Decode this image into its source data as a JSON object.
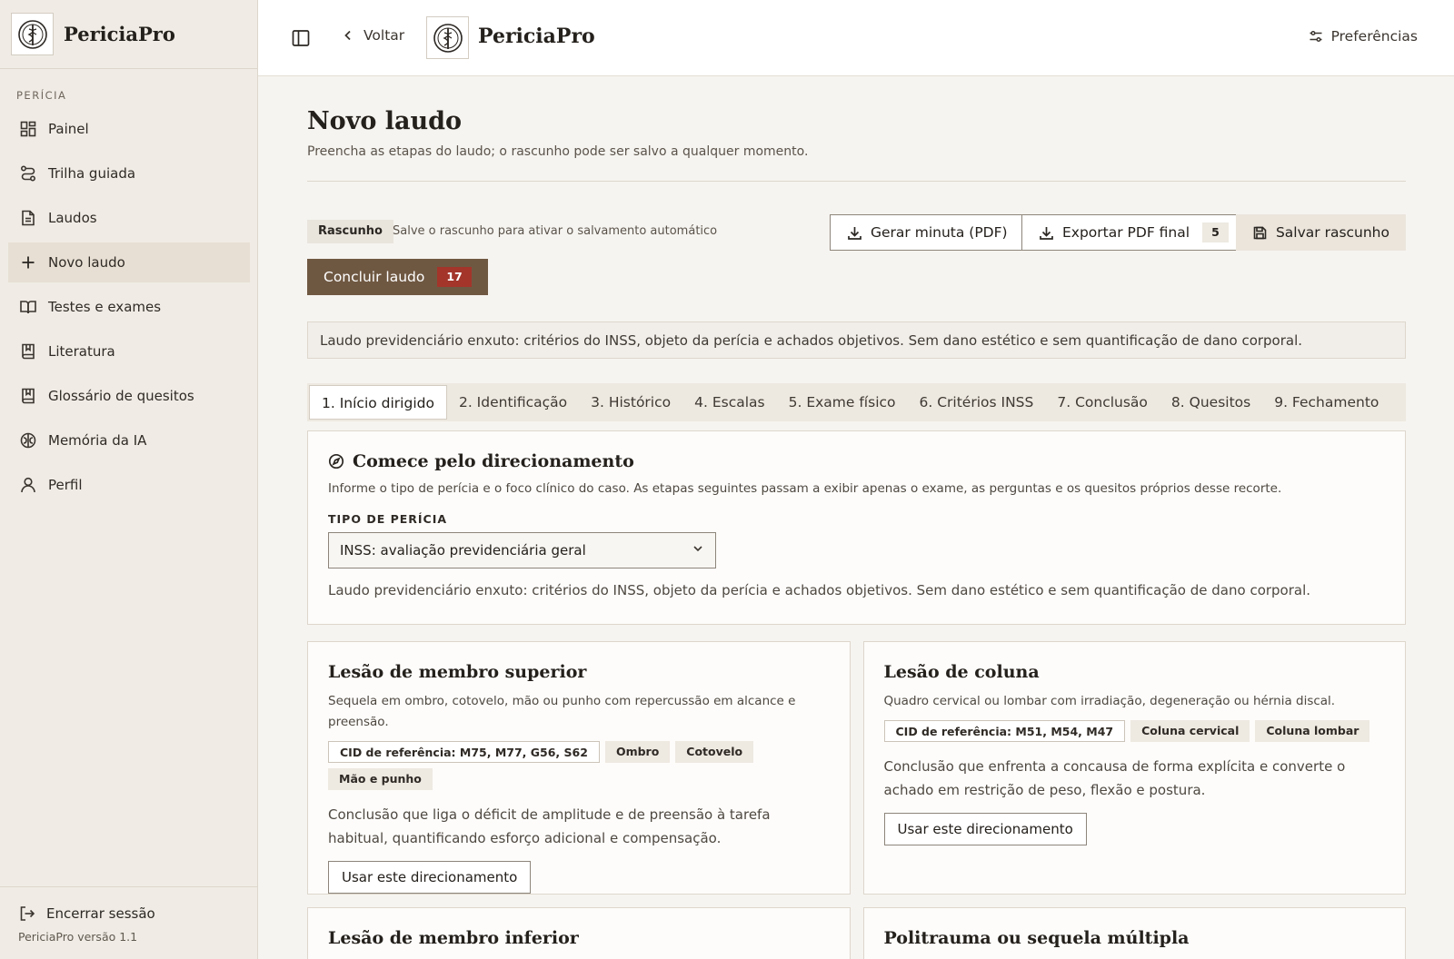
{
  "brand": {
    "name": "PericiaPro"
  },
  "sidebar": {
    "section": "PERÍCIA",
    "items": [
      {
        "label": "Painel",
        "icon": "dashboard-icon"
      },
      {
        "label": "Trilha guiada",
        "icon": "route-icon"
      },
      {
        "label": "Laudos",
        "icon": "file-icon"
      },
      {
        "label": "Novo laudo",
        "icon": "plus-icon",
        "active": true
      },
      {
        "label": "Testes e exames",
        "icon": "book-icon"
      },
      {
        "label": "Literatura",
        "icon": "book-bookmark-icon"
      },
      {
        "label": "Glossário de quesitos",
        "icon": "book-bookmark-icon"
      },
      {
        "label": "Memória da IA",
        "icon": "brain-icon"
      },
      {
        "label": "Perfil",
        "icon": "user-icon"
      }
    ],
    "logout": "Encerrar sessão",
    "version": "PericiaPro versão 1.1"
  },
  "topbar": {
    "back": "Voltar",
    "brand": "PericiaPro",
    "preferences": "Preferências"
  },
  "main": {
    "title": "Novo laudo",
    "subtitle": "Preencha as etapas do laudo; o rascunho pode ser salvo a qualquer momento.",
    "draft_badge": "Rascunho",
    "draft_hint": "Salve o rascunho para ativar o salvamento automático",
    "btn_minuta": "Gerar minuta (PDF)",
    "btn_export": "Exportar PDF final",
    "export_count": "5",
    "btn_save": "Salvar rascunho",
    "btn_conclude": "Concluir laudo",
    "conclude_count": "17",
    "note": "Laudo previdenciário enxuto: critérios do INSS, objeto da perícia e achados objetivos. Sem dano estético e sem quantificação de dano corporal.",
    "tabs": [
      "1. Início dirigido",
      "2. Identificação",
      "3. Histórico",
      "4. Escalas",
      "5. Exame físico",
      "6. Critérios INSS",
      "7. Conclusão",
      "8. Quesitos",
      "9. Fechamento"
    ],
    "direction": {
      "title": "Comece pelo direcionamento",
      "desc": "Informe o tipo de perícia e o foco clínico do caso. As etapas seguintes passam a exibir apenas o exame, as perguntas e os quesitos próprios desse recorte.",
      "field_label": "TIPO DE PERÍCIA",
      "select_value": "INSS: avaliação previdenciária geral",
      "help": "Laudo previdenciário enxuto: critérios do INSS, objeto da perícia e achados objetivos. Sem dano estético e sem quantificação de dano corporal."
    },
    "options": [
      {
        "title": "Lesão de membro superior",
        "desc": "Sequela em ombro, cotovelo, mão ou punho com repercussão em alcance e preensão.",
        "chips": [
          "CID de referência: M75, M77, G56, S62",
          "Ombro",
          "Cotovelo",
          "Mão e punho"
        ],
        "text": "Conclusão que liga o déficit de amplitude e de preensão à tarefa habitual, quantificando esforço adicional e compensação.",
        "button": "Usar este direcionamento"
      },
      {
        "title": "Lesão de coluna",
        "desc": "Quadro cervical ou lombar com irradiação, degeneração ou hérnia discal.",
        "chips": [
          "CID de referência: M51, M54, M47",
          "Coluna cervical",
          "Coluna lombar"
        ],
        "text": "Conclusão que enfrenta a concausa de forma explícita e converte o achado em restrição de peso, flexão e postura.",
        "button": "Usar este direcionamento"
      }
    ],
    "options_more": [
      {
        "title": "Lesão de membro inferior"
      },
      {
        "title": "Politrauma ou sequela múltipla"
      }
    ]
  }
}
